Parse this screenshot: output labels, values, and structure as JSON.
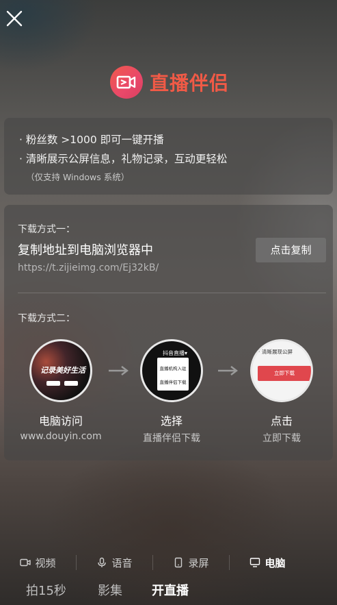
{
  "brand": {
    "name": "直播伴侣"
  },
  "features": {
    "items": [
      "· 粉丝数 >1000 即可一键开播",
      "· 清晰展示公屏信息，礼物记录，互动更轻松"
    ],
    "note": "（仅支持 Windows 系统）"
  },
  "method1": {
    "label": "下载方式一：",
    "title": "复制地址到电脑浏览器中",
    "url": "https://t.zijieimg.com/Ej32kB/",
    "copy_label": "点击复制"
  },
  "method2": {
    "label": "下载方式二：",
    "steps": [
      {
        "title": "电脑访问",
        "sub": "www.douyin.com",
        "thumb_text": "记录美好生活"
      },
      {
        "title": "选择",
        "sub": "直播伴侣下载",
        "thumb_header": "抖音直播▾",
        "thumb_lines": [
          "直播机构入驻",
          "直播伴侣下载"
        ]
      },
      {
        "title": "点击",
        "sub": "立即下载",
        "thumb_line": "清晰展现公屏",
        "thumb_btn": "立即下载"
      }
    ]
  },
  "live_tabs": [
    {
      "label": "视频",
      "icon": "video-camera-icon"
    },
    {
      "label": "语音",
      "icon": "microphone-icon"
    },
    {
      "label": "录屏",
      "icon": "phone-screen-icon"
    },
    {
      "label": "电脑",
      "icon": "monitor-icon",
      "active": true
    }
  ],
  "modes": [
    {
      "label": "拍15秒"
    },
    {
      "label": "影集"
    },
    {
      "label": "开直播",
      "active": true
    }
  ],
  "colors": {
    "brand": "#f15a46",
    "download_button": "#e0474d"
  }
}
